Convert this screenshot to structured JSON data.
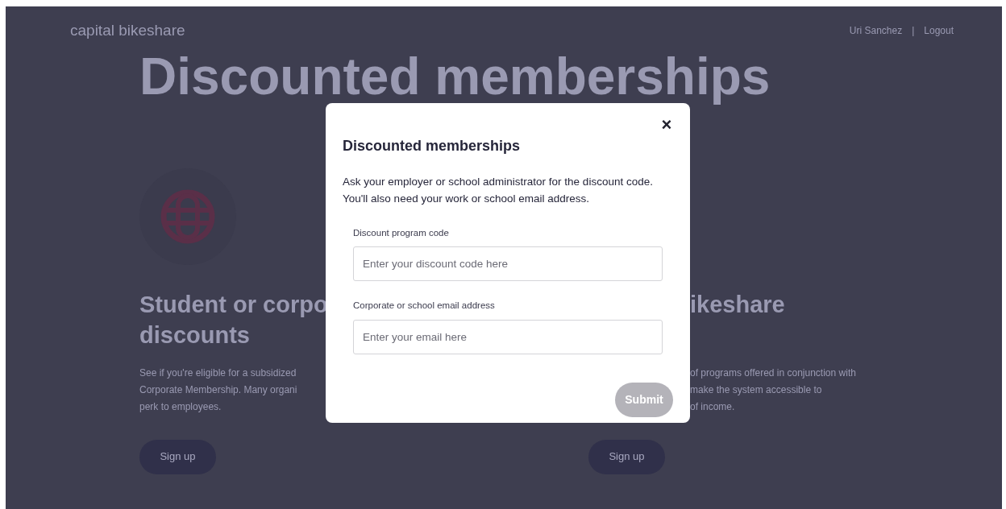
{
  "header": {
    "logo": "capital bikeshare",
    "user_name": "Uri Sanchez",
    "separator": "|",
    "logout": "Logout"
  },
  "page_title": "Discounted memberships",
  "cards": [
    {
      "heading_lines": [
        "Student or corpo",
        "discounts"
      ],
      "body_lines": [
        "See if you're eligible for a subsidized",
        "Corporate Membership. Many organi",
        "perk to employees."
      ],
      "button": "Sign up"
    },
    {
      "heading_lines": [
        "ikeshare"
      ],
      "body_lines": [
        "of programs offered in conjunction with",
        "make the system accessible to",
        "of income."
      ],
      "button": "Sign up"
    }
  ],
  "modal": {
    "title": "Discounted memberships",
    "close": "×",
    "description": "Ask your employer or school administrator for the discount code.\nYou'll also need your work or school email address.",
    "fields": [
      {
        "label": "Discount program code",
        "placeholder": "Enter your discount code here"
      },
      {
        "label": "Corporate or school email address",
        "placeholder": "Enter your email here"
      }
    ],
    "submit": {
      "label": "Submit",
      "disabled": true
    }
  }
}
